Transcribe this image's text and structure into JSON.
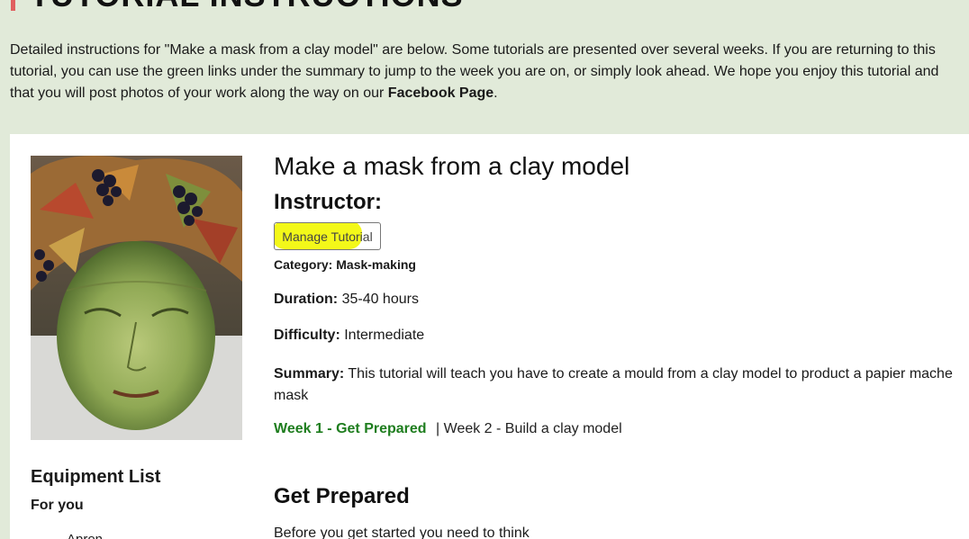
{
  "page": {
    "heading": "TUTORIAL INSTRUCTIONS",
    "intro_text": "Detailed instructions for \"Make a mask from a clay model\" are below. Some tutorials are presented over several weeks. If you are returning to this tutorial, you can use the green links under the summary to jump to the week you are on, or simply look ahead. We hope you enjoy this tutorial and that you will post photos of your work along the way on our ",
    "intro_link": "Facebook Page",
    "intro_end": "."
  },
  "tutorial": {
    "title": "Make a mask from a clay model",
    "instructor_label": "Instructor:",
    "manage_button": "Manage Tutorial",
    "category_label": "Category:",
    "category_value": "Mask-making",
    "duration_label": "Duration:",
    "duration_value": "35-40 hours",
    "difficulty_label": "Difficulty:",
    "difficulty_value": "Intermediate",
    "summary_label": "Summary:",
    "summary_value": "This tutorial will teach you have to create a mould from a clay model to product a papier mache mask",
    "weeks": [
      {
        "label": "Week 1 - Get Prepared",
        "active": true
      },
      {
        "label": "Week 2 - Build a clay model",
        "active": false
      }
    ],
    "week_separator": "|",
    "section_title": "Get Prepared",
    "section_text": "Before you get started you need to think"
  },
  "sidebar": {
    "equipment_title": "Equipment List",
    "for_you": "For you",
    "first_item": "Apron"
  },
  "colors": {
    "background": "#e1ead9",
    "link_green": "#1e7d1e",
    "highlight": "#f2f700"
  }
}
